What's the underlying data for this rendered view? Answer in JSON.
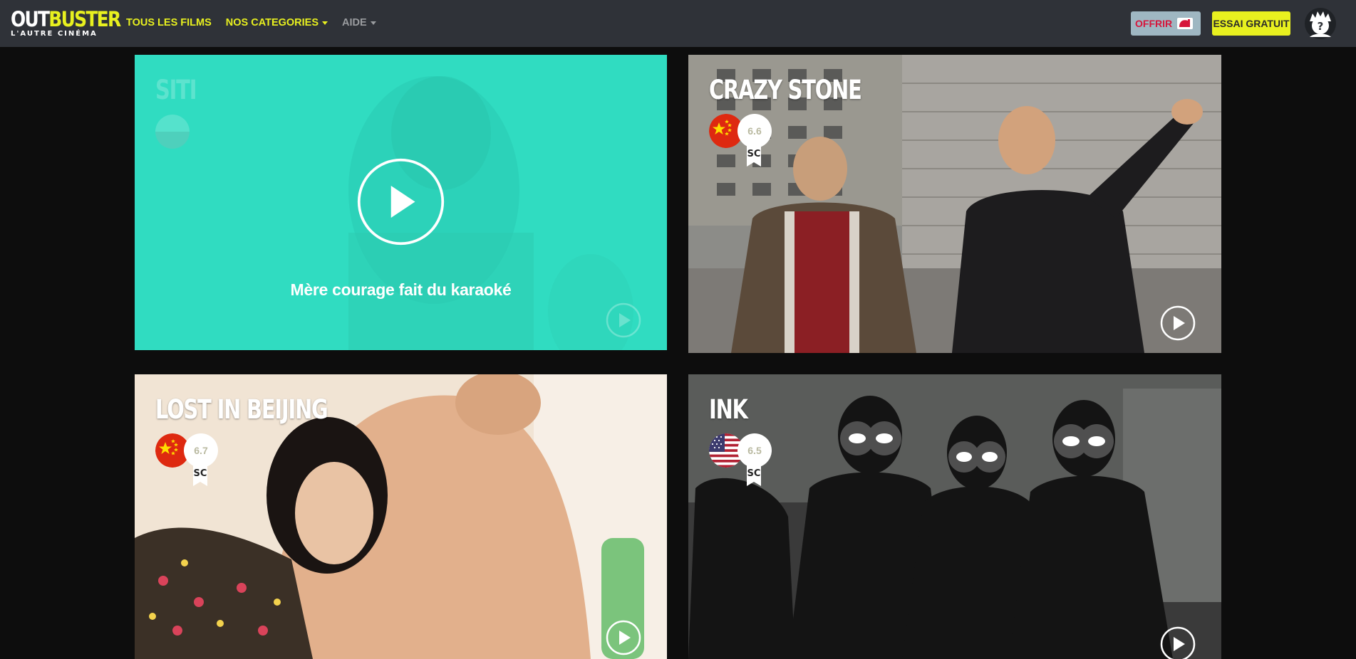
{
  "nav": {
    "logo_out": "OUT",
    "logo_buster": "BUSTER",
    "logo_sub": "L'AUTRE CINÉMA",
    "links": [
      "TOUS LES FILMS",
      "NOS CATEGORIES",
      "AIDE"
    ],
    "offrir_label": "OFFRIR",
    "essai_label": "ESSAI GRATUIT",
    "help_icon": "help-mascot-icon",
    "gift_icon": "gift-card-icon"
  },
  "films": [
    {
      "title": "SITI",
      "tagline": "Mère courage fait du karaoké",
      "state": "hover",
      "accent": "#30dcc1"
    },
    {
      "title": "CRAZY STONE",
      "country_flag": "china-flag-icon",
      "rating": "6.6",
      "badge": "SC"
    },
    {
      "title": "LOST IN BEIJING",
      "country_flag": "china-flag-icon",
      "rating": "6.7",
      "badge": "SC"
    },
    {
      "title": "INK",
      "country_flag": "usa-flag-icon",
      "rating": "6.5",
      "badge": "SC"
    }
  ],
  "colors": {
    "brand_yellow": "#e8f01f",
    "navbar_bg": "#2f3238",
    "page_bg": "#0d0d0d",
    "offrir_red": "#d6153b",
    "offrir_bg": "#9fb7c2"
  }
}
